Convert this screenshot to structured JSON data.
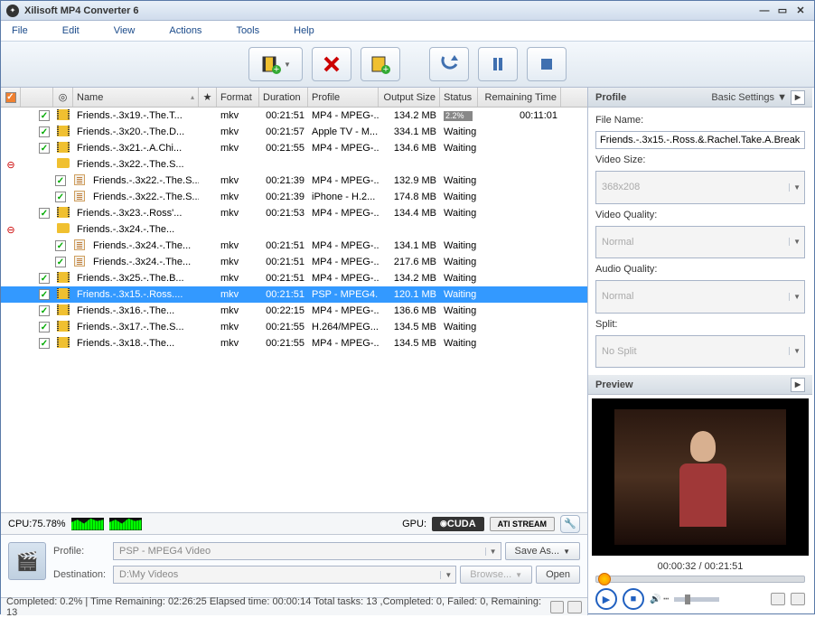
{
  "window": {
    "title": "Xilisoft MP4 Converter 6"
  },
  "menu": {
    "file": "File",
    "edit": "Edit",
    "view": "View",
    "actions": "Actions",
    "tools": "Tools",
    "help": "Help"
  },
  "columns": {
    "name": "Name",
    "format": "Format",
    "duration": "Duration",
    "profile": "Profile",
    "output_size": "Output Size",
    "status": "Status",
    "remaining": "Remaining Time"
  },
  "rows": [
    {
      "indent": 0,
      "checked": true,
      "icon": "film",
      "name": "Friends.-.3x19.-.The.T...",
      "format": "mkv",
      "duration": "00:21:51",
      "profile": "MP4 - MPEG-...",
      "size": "134.2 MB",
      "status": "progress",
      "progress": "2.2%",
      "remaining": "00:11:01"
    },
    {
      "indent": 0,
      "checked": true,
      "icon": "film",
      "name": "Friends.-.3x20.-.The.D...",
      "format": "mkv",
      "duration": "00:21:57",
      "profile": "Apple TV - M...",
      "size": "334.1 MB",
      "status": "Waiting"
    },
    {
      "indent": 0,
      "checked": true,
      "icon": "film",
      "name": "Friends.-.3x21.-.A.Chi...",
      "format": "mkv",
      "duration": "00:21:55",
      "profile": "MP4 - MPEG-...",
      "size": "134.6 MB",
      "status": "Waiting"
    },
    {
      "indent": 0,
      "checked": null,
      "expand": "minus",
      "icon": "folder",
      "name": "Friends.-.3x22.-.The.S...",
      "format": "",
      "duration": "",
      "profile": "",
      "size": "",
      "status": ""
    },
    {
      "indent": 1,
      "checked": true,
      "icon": "list",
      "name": "Friends.-.3x22.-.The.S...",
      "format": "mkv",
      "duration": "00:21:39",
      "profile": "MP4 - MPEG-...",
      "size": "132.9 MB",
      "status": "Waiting"
    },
    {
      "indent": 1,
      "checked": true,
      "icon": "list",
      "name": "Friends.-.3x22.-.The.S...",
      "format": "mkv",
      "duration": "00:21:39",
      "profile": "iPhone - H.2...",
      "size": "174.8 MB",
      "status": "Waiting"
    },
    {
      "indent": 0,
      "checked": true,
      "icon": "film",
      "name": "Friends.-.3x23.-.Ross'...",
      "format": "mkv",
      "duration": "00:21:53",
      "profile": "MP4 - MPEG-...",
      "size": "134.4 MB",
      "status": "Waiting"
    },
    {
      "indent": 0,
      "checked": null,
      "expand": "minus",
      "icon": "folder",
      "name": "Friends.-.3x24.-.The...",
      "format": "",
      "duration": "",
      "profile": "",
      "size": "",
      "status": ""
    },
    {
      "indent": 1,
      "checked": true,
      "icon": "list",
      "name": "Friends.-.3x24.-.The...",
      "format": "mkv",
      "duration": "00:21:51",
      "profile": "MP4 - MPEG-...",
      "size": "134.1 MB",
      "status": "Waiting"
    },
    {
      "indent": 1,
      "checked": true,
      "icon": "list",
      "name": "Friends.-.3x24.-.The...",
      "format": "mkv",
      "duration": "00:21:51",
      "profile": "MP4 - MPEG-...",
      "size": "217.6 MB",
      "status": "Waiting"
    },
    {
      "indent": 0,
      "checked": true,
      "icon": "film",
      "name": "Friends.-.3x25.-.The.B...",
      "format": "mkv",
      "duration": "00:21:51",
      "profile": "MP4 - MPEG-...",
      "size": "134.2 MB",
      "status": "Waiting"
    },
    {
      "indent": 0,
      "checked": true,
      "selected": true,
      "icon": "film",
      "name": "Friends.-.3x15.-.Ross....",
      "format": "mkv",
      "duration": "00:21:51",
      "profile": "PSP - MPEG4...",
      "size": "120.1 MB",
      "status": "Waiting"
    },
    {
      "indent": 0,
      "checked": true,
      "icon": "film",
      "name": "Friends.-.3x16.-.The...",
      "format": "mkv",
      "duration": "00:22:15",
      "profile": "MP4 - MPEG-...",
      "size": "136.6 MB",
      "status": "Waiting"
    },
    {
      "indent": 0,
      "checked": true,
      "icon": "film",
      "name": "Friends.-.3x17.-.The.S...",
      "format": "mkv",
      "duration": "00:21:55",
      "profile": "H.264/MPEG...",
      "size": "134.5 MB",
      "status": "Waiting"
    },
    {
      "indent": 0,
      "checked": true,
      "icon": "film",
      "name": "Friends.-.3x18.-.The...",
      "format": "mkv",
      "duration": "00:21:55",
      "profile": "MP4 - MPEG-...",
      "size": "134.5 MB",
      "status": "Waiting"
    }
  ],
  "cpu": {
    "label": "CPU:75.78%"
  },
  "gpu": {
    "label": "GPU:"
  },
  "badges": {
    "cuda": "CUDA",
    "ati": "ATI STREAM"
  },
  "profile_area": {
    "profile_label": "Profile:",
    "profile_value": "PSP - MPEG4 Video",
    "dest_label": "Destination:",
    "dest_value": "D:\\My Videos",
    "saveas": "Save As...",
    "browse": "Browse...",
    "open": "Open"
  },
  "statusbar": {
    "text": "Completed: 0.2% | Time Remaining: 02:26:25 Elapsed time: 00:00:14 Total tasks: 13 ,Completed: 0, Failed: 0, Remaining: 13"
  },
  "right_panel": {
    "profile_header": "Profile",
    "basic": "Basic Settings",
    "filename_label": "File Name:",
    "filename_value": "Friends.-.3x15.-.Ross.&.Rachel.Take.A.Break",
    "videosize_label": "Video Size:",
    "videosize_value": "368x208",
    "videoq_label": "Video Quality:",
    "videoq_value": "Normal",
    "audioq_label": "Audio Quality:",
    "audioq_value": "Normal",
    "split_label": "Split:",
    "split_value": "No Split",
    "preview_header": "Preview",
    "time": "00:00:32 / 00:21:51"
  }
}
